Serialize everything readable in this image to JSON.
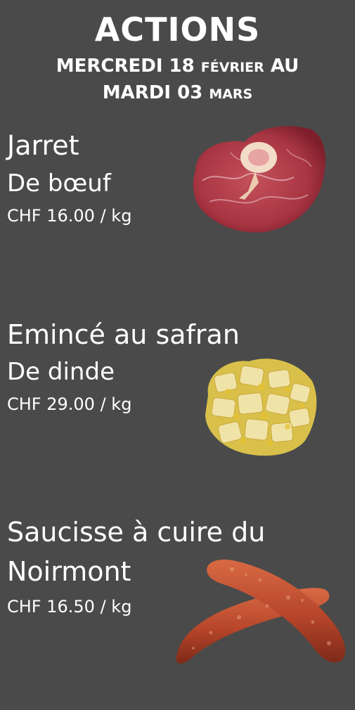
{
  "header": {
    "title": "ACTIONS",
    "line1_a": "MERCREDI 18 ",
    "line1_b": "FÉVRIER",
    "line1_c": " AU",
    "line2_a": "MARDI 03 ",
    "line2_b": "MARS"
  },
  "products": [
    {
      "name": "Jarret",
      "subtitle": "De bœuf",
      "price": "CHF 16.00 / kg",
      "image": "beef-shank-icon"
    },
    {
      "name": "Emincé au safran",
      "subtitle": "De dinde",
      "price": "CHF 29.00 / kg",
      "image": "saffron-turkey-icon"
    },
    {
      "name_line1": "Saucisse à cuire du",
      "name_line2": "Noirmont",
      "price": "CHF 16.50 / kg",
      "image": "sausage-icon"
    }
  ],
  "colors": {
    "background": "#4a4a4a",
    "text": "#ffffff"
  }
}
